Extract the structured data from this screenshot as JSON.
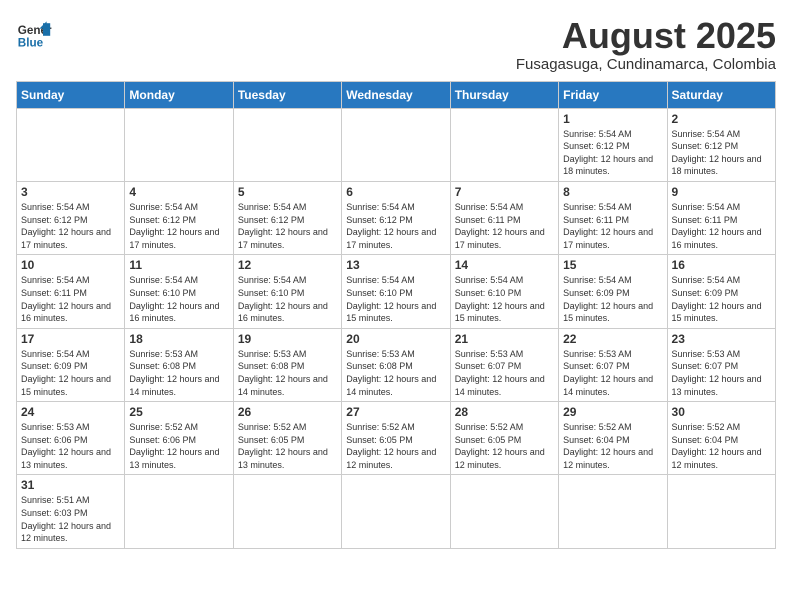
{
  "header": {
    "logo_general": "General",
    "logo_blue": "Blue",
    "title": "August 2025",
    "subtitle": "Fusagasuga, Cundinamarca, Colombia"
  },
  "weekdays": [
    "Sunday",
    "Monday",
    "Tuesday",
    "Wednesday",
    "Thursday",
    "Friday",
    "Saturday"
  ],
  "weeks": [
    [
      {
        "day": "",
        "info": ""
      },
      {
        "day": "",
        "info": ""
      },
      {
        "day": "",
        "info": ""
      },
      {
        "day": "",
        "info": ""
      },
      {
        "day": "",
        "info": ""
      },
      {
        "day": "1",
        "info": "Sunrise: 5:54 AM\nSunset: 6:12 PM\nDaylight: 12 hours and 18 minutes."
      },
      {
        "day": "2",
        "info": "Sunrise: 5:54 AM\nSunset: 6:12 PM\nDaylight: 12 hours and 18 minutes."
      }
    ],
    [
      {
        "day": "3",
        "info": "Sunrise: 5:54 AM\nSunset: 6:12 PM\nDaylight: 12 hours and 17 minutes."
      },
      {
        "day": "4",
        "info": "Sunrise: 5:54 AM\nSunset: 6:12 PM\nDaylight: 12 hours and 17 minutes."
      },
      {
        "day": "5",
        "info": "Sunrise: 5:54 AM\nSunset: 6:12 PM\nDaylight: 12 hours and 17 minutes."
      },
      {
        "day": "6",
        "info": "Sunrise: 5:54 AM\nSunset: 6:12 PM\nDaylight: 12 hours and 17 minutes."
      },
      {
        "day": "7",
        "info": "Sunrise: 5:54 AM\nSunset: 6:11 PM\nDaylight: 12 hours and 17 minutes."
      },
      {
        "day": "8",
        "info": "Sunrise: 5:54 AM\nSunset: 6:11 PM\nDaylight: 12 hours and 17 minutes."
      },
      {
        "day": "9",
        "info": "Sunrise: 5:54 AM\nSunset: 6:11 PM\nDaylight: 12 hours and 16 minutes."
      }
    ],
    [
      {
        "day": "10",
        "info": "Sunrise: 5:54 AM\nSunset: 6:11 PM\nDaylight: 12 hours and 16 minutes."
      },
      {
        "day": "11",
        "info": "Sunrise: 5:54 AM\nSunset: 6:10 PM\nDaylight: 12 hours and 16 minutes."
      },
      {
        "day": "12",
        "info": "Sunrise: 5:54 AM\nSunset: 6:10 PM\nDaylight: 12 hours and 16 minutes."
      },
      {
        "day": "13",
        "info": "Sunrise: 5:54 AM\nSunset: 6:10 PM\nDaylight: 12 hours and 15 minutes."
      },
      {
        "day": "14",
        "info": "Sunrise: 5:54 AM\nSunset: 6:10 PM\nDaylight: 12 hours and 15 minutes."
      },
      {
        "day": "15",
        "info": "Sunrise: 5:54 AM\nSunset: 6:09 PM\nDaylight: 12 hours and 15 minutes."
      },
      {
        "day": "16",
        "info": "Sunrise: 5:54 AM\nSunset: 6:09 PM\nDaylight: 12 hours and 15 minutes."
      }
    ],
    [
      {
        "day": "17",
        "info": "Sunrise: 5:54 AM\nSunset: 6:09 PM\nDaylight: 12 hours and 15 minutes."
      },
      {
        "day": "18",
        "info": "Sunrise: 5:53 AM\nSunset: 6:08 PM\nDaylight: 12 hours and 14 minutes."
      },
      {
        "day": "19",
        "info": "Sunrise: 5:53 AM\nSunset: 6:08 PM\nDaylight: 12 hours and 14 minutes."
      },
      {
        "day": "20",
        "info": "Sunrise: 5:53 AM\nSunset: 6:08 PM\nDaylight: 12 hours and 14 minutes."
      },
      {
        "day": "21",
        "info": "Sunrise: 5:53 AM\nSunset: 6:07 PM\nDaylight: 12 hours and 14 minutes."
      },
      {
        "day": "22",
        "info": "Sunrise: 5:53 AM\nSunset: 6:07 PM\nDaylight: 12 hours and 14 minutes."
      },
      {
        "day": "23",
        "info": "Sunrise: 5:53 AM\nSunset: 6:07 PM\nDaylight: 12 hours and 13 minutes."
      }
    ],
    [
      {
        "day": "24",
        "info": "Sunrise: 5:53 AM\nSunset: 6:06 PM\nDaylight: 12 hours and 13 minutes."
      },
      {
        "day": "25",
        "info": "Sunrise: 5:52 AM\nSunset: 6:06 PM\nDaylight: 12 hours and 13 minutes."
      },
      {
        "day": "26",
        "info": "Sunrise: 5:52 AM\nSunset: 6:05 PM\nDaylight: 12 hours and 13 minutes."
      },
      {
        "day": "27",
        "info": "Sunrise: 5:52 AM\nSunset: 6:05 PM\nDaylight: 12 hours and 12 minutes."
      },
      {
        "day": "28",
        "info": "Sunrise: 5:52 AM\nSunset: 6:05 PM\nDaylight: 12 hours and 12 minutes."
      },
      {
        "day": "29",
        "info": "Sunrise: 5:52 AM\nSunset: 6:04 PM\nDaylight: 12 hours and 12 minutes."
      },
      {
        "day": "30",
        "info": "Sunrise: 5:52 AM\nSunset: 6:04 PM\nDaylight: 12 hours and 12 minutes."
      }
    ],
    [
      {
        "day": "31",
        "info": "Sunrise: 5:51 AM\nSunset: 6:03 PM\nDaylight: 12 hours and 12 minutes."
      },
      {
        "day": "",
        "info": ""
      },
      {
        "day": "",
        "info": ""
      },
      {
        "day": "",
        "info": ""
      },
      {
        "day": "",
        "info": ""
      },
      {
        "day": "",
        "info": ""
      },
      {
        "day": "",
        "info": ""
      }
    ]
  ]
}
